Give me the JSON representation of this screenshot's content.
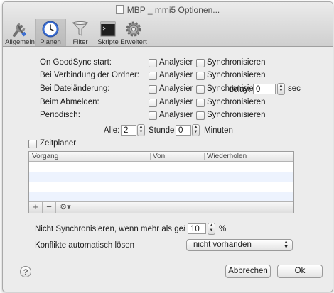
{
  "window": {
    "title": "MBP _ mmi5 Optionen..."
  },
  "toolbar": {
    "items": [
      {
        "label": "Allgemein",
        "icon": "wrench-screwdriver-icon"
      },
      {
        "label": "Planen",
        "icon": "clock-icon"
      },
      {
        "label": "Filter",
        "icon": "funnel-icon"
      },
      {
        "label": "Skripte",
        "icon": "terminal-icon"
      },
      {
        "label": "Erweitert",
        "icon": "gear-icon"
      }
    ]
  },
  "triggers": {
    "analyze_label": "Analysier",
    "sync_label": "Synchronisieren",
    "rows": [
      {
        "label": "On GoodSync start:"
      },
      {
        "label": "Bei Verbindung der Ordner:"
      },
      {
        "label": "Bei Dateiänderung:",
        "delay_label": "delay:",
        "delay_value": "0",
        "delay_unit": "sec"
      },
      {
        "label": "Beim Abmelden:"
      },
      {
        "label": "Periodisch:"
      }
    ],
    "periodic": {
      "alle_label": "Alle:",
      "hours_value": "2",
      "hours_label": "Stunden",
      "minutes_value": "0",
      "minutes_label": "Minuten"
    }
  },
  "scheduler": {
    "checkbox_label": "Zeitplaner",
    "columns": [
      "Vorgang",
      "Von",
      "Wiederholen"
    ],
    "add_icon": "plus-icon",
    "remove_icon": "minus-icon",
    "actions_icon": "gear-icon"
  },
  "limits": {
    "dont_sync_label": "Nicht Synchronisieren, wenn mehr als geändert:",
    "dont_sync_value": "10",
    "percent_unit": "%",
    "conflicts_label": "Konflikte automatisch lösen",
    "conflicts_value": "nicht vorhanden"
  },
  "footer": {
    "help_label": "?",
    "cancel_label": "Abbrechen",
    "ok_label": "Ok"
  }
}
